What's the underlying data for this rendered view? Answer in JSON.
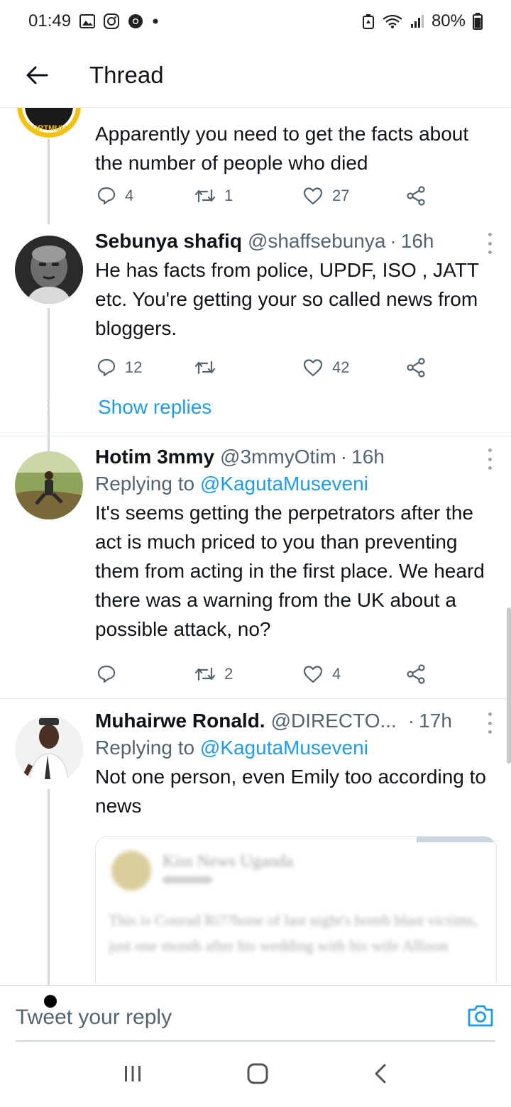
{
  "status": {
    "time": "01:49",
    "battery": "80%",
    "icons_left": [
      "gallery-icon",
      "instagram-icon",
      "chrome-icon",
      "dot-icon"
    ],
    "icons_right": [
      "recycle-icon",
      "wifi-icon",
      "signal-icon",
      "battery-icon"
    ]
  },
  "header": {
    "title": "Thread"
  },
  "tweets": [
    {
      "text": "Apparently you need to get the facts about the number of people who died",
      "replies": "4",
      "retweets": "1",
      "likes": "27"
    },
    {
      "name": "Sebunya shafiq",
      "handle": "@shaffsebunya",
      "time": "16h",
      "text": "He has facts from police, UPDF, ISO , JATT etc. You're getting your so called news from bloggers.",
      "replies": "12",
      "retweets": "",
      "likes": "42"
    },
    {
      "name": "Hotim 3mmy",
      "handle": "@3mmyOtim",
      "time": "16h",
      "replying_label": "Replying to",
      "replying_to": "@KagutaMuseveni",
      "text": "It's seems getting the perpetrators after the act is much priced to you than preventing them from acting in the first place. We heard there was a warning from the UK about a possible attack, no?",
      "replies": "",
      "retweets": "2",
      "likes": "4"
    },
    {
      "name": "Muhairwe Ronald.",
      "handle": "@DIRECTO...",
      "time": "17h",
      "replying_label": "Replying to",
      "replying_to": "@KagutaMuseveni",
      "text": "Not one person, even Emily too according to news",
      "embedded": {
        "source": "Kiss News Uganda",
        "text": "This is Conrad Ri??hone of last night's bomb blast victims, just one month after his wedding with his wife Allison"
      }
    }
  ],
  "show_replies": "Show replies",
  "reply_bar": {
    "placeholder": "Tweet your reply"
  },
  "colors": {
    "accent": "#1d9bf0",
    "muted": "#536471",
    "text": "#0f1419",
    "line": "#cfd9de"
  }
}
